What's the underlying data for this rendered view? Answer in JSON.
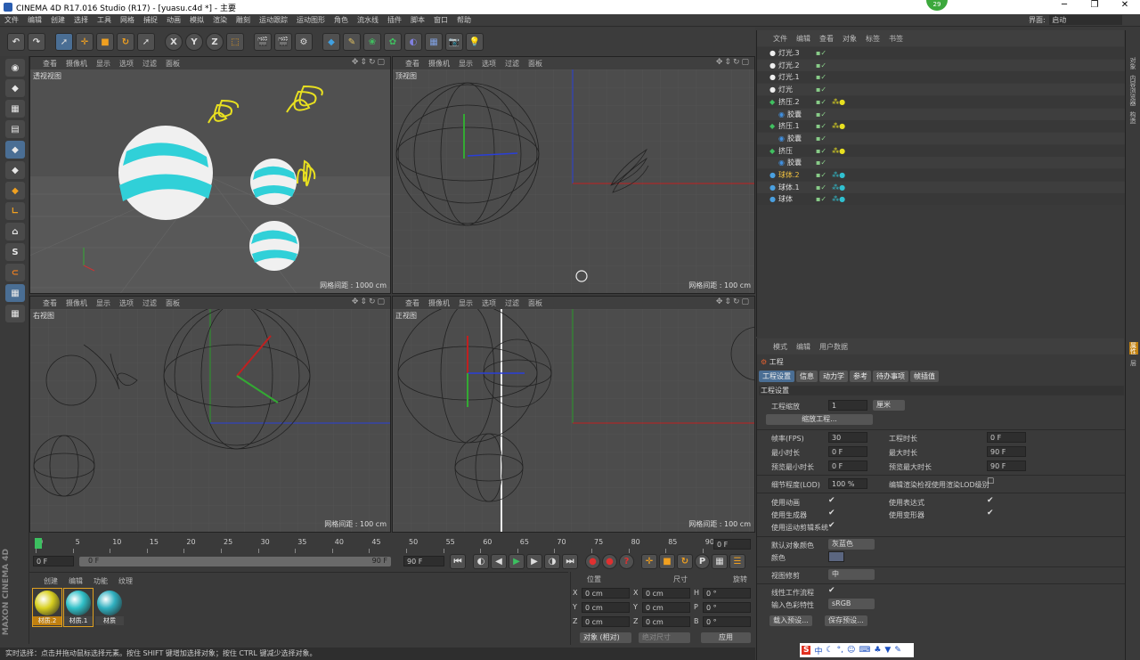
{
  "window": {
    "title": "CINEMA 4D R17.016 Studio (R17) - [yuasu.c4d *] - 主要",
    "minimize": "─",
    "maximize": "❐",
    "close": "✕",
    "badge": "29"
  },
  "menubar": [
    "文件",
    "编辑",
    "创建",
    "选择",
    "工具",
    "网格",
    "捕捉",
    "动画",
    "模拟",
    "渲染",
    "雕刻",
    "运动跟踪",
    "运动图形",
    "角色",
    "流水线",
    "插件",
    "脚本",
    "窗口",
    "帮助"
  ],
  "layout": {
    "label": "界面:",
    "value": "启动"
  },
  "viewport_menu": [
    "查看",
    "摄像机",
    "显示",
    "选项",
    "过滤",
    "面板"
  ],
  "viewports": [
    {
      "label": "透视视图",
      "grid": "网格间距 : 1000 cm"
    },
    {
      "label": "顶视图",
      "grid": "网格间距 : 100 cm"
    },
    {
      "label": "右视图",
      "grid": "网格间距 : 100 cm"
    },
    {
      "label": "正视图",
      "grid": "网格间距 : 100 cm"
    }
  ],
  "timeline": {
    "ticks": [
      "0",
      "5",
      "10",
      "15",
      "20",
      "25",
      "30",
      "35",
      "40",
      "45",
      "50",
      "55",
      "60",
      "65",
      "70",
      "75",
      "80",
      "85",
      "90"
    ],
    "current_frame": "0 F",
    "start": "0 F",
    "range_start": "0 F",
    "range_end": "90 F",
    "end": "90 F"
  },
  "material_menu": [
    "创建",
    "编辑",
    "功能",
    "纹理"
  ],
  "materials": [
    {
      "name": "材质.2",
      "color": "#d8d020"
    },
    {
      "name": "材质.1",
      "color": "#30c0c8"
    },
    {
      "name": "材质",
      "color": "#30b0c0"
    }
  ],
  "coords": {
    "headers": [
      "位置",
      "尺寸",
      "旋转"
    ],
    "rows": [
      {
        "a": "X",
        "av": "0 cm",
        "b": "X",
        "bv": "0 cm",
        "c": "H",
        "cv": "0 °"
      },
      {
        "a": "Y",
        "av": "0 cm",
        "b": "Y",
        "bv": "0 cm",
        "c": "P",
        "cv": "0 °"
      },
      {
        "a": "Z",
        "av": "0 cm",
        "b": "Z",
        "bv": "0 cm",
        "c": "B",
        "cv": "0 °"
      }
    ],
    "mode": "对象 (相对)",
    "size_mode": "绝对尺寸",
    "apply": "应用"
  },
  "status": "实时选择：点击并拖动鼠标选择元素。按住 SHIFT 键增加选择对象；按住 CTRL 键减少选择对象。",
  "object_menu": [
    "文件",
    "编辑",
    "查看",
    "对象",
    "标签",
    "书签"
  ],
  "objects": [
    {
      "name": "灯光.3",
      "indent": 0,
      "type": "light"
    },
    {
      "name": "灯光.2",
      "indent": 0,
      "type": "light"
    },
    {
      "name": "灯光.1",
      "indent": 0,
      "type": "light"
    },
    {
      "name": "灯光",
      "indent": 0,
      "type": "light"
    },
    {
      "name": "挤压.2",
      "indent": 0,
      "type": "squash"
    },
    {
      "name": "胶囊",
      "indent": 1,
      "type": "capsule"
    },
    {
      "name": "挤压.1",
      "indent": 0,
      "type": "squash"
    },
    {
      "name": "胶囊",
      "indent": 1,
      "type": "capsule"
    },
    {
      "name": "挤压",
      "indent": 0,
      "type": "squash"
    },
    {
      "name": "胶囊",
      "indent": 1,
      "type": "capsule"
    },
    {
      "name": "球体.2",
      "indent": 0,
      "type": "sphere"
    },
    {
      "name": "球体.1",
      "indent": 0,
      "type": "sphere"
    },
    {
      "name": "球体",
      "indent": 0,
      "type": "sphere"
    }
  ],
  "attr_menu": [
    "模式",
    "编辑",
    "用户数据"
  ],
  "attr": {
    "title": "工程",
    "tabs": [
      "工程设置",
      "信息",
      "动力学",
      "参考",
      "待办事项",
      "帧插值"
    ],
    "section": "工程设置",
    "scale_label": "工程缩放",
    "scale_value": "1",
    "scale_unit": "厘米",
    "scale_button": "缩放工程...",
    "fps_label": "帧率(FPS)",
    "fps_value": "30",
    "time_label": "工程时长",
    "time_value": "0 F",
    "min_label": "最小时长",
    "min_value": "0 F",
    "max_label": "最大时长",
    "max_value": "90 F",
    "pmin_label": "预览最小时长",
    "pmin_value": "0 F",
    "pmax_label": "预览最大时长",
    "pmax_value": "90 F",
    "lod_label": "细节程度(LOD)",
    "lod_value": "100 %",
    "lod_render_label": "编辑渲染检视使用渲染LOD级别",
    "anim_label": "使用动画",
    "expr_label": "使用表达式",
    "gen_label": "使用生成器",
    "deform_label": "使用变形器",
    "motion_label": "使用运动剪辑系统",
    "defcolor_label": "默认对象颜色",
    "defcolor_value": "灰蓝色",
    "color_label": "颜色",
    "clip_label": "视图修剪",
    "clip_value": "中",
    "linear_label": "线性工作流程",
    "profile_label": "输入色彩特性",
    "profile_value": "sRGB",
    "load_btn": "载入预设...",
    "save_btn": "保存预设..."
  },
  "right_tabs": [
    "对象",
    "内容浏览器",
    "构造"
  ],
  "right_tabs2": [
    "属性",
    "层"
  ],
  "ime": "中"
}
